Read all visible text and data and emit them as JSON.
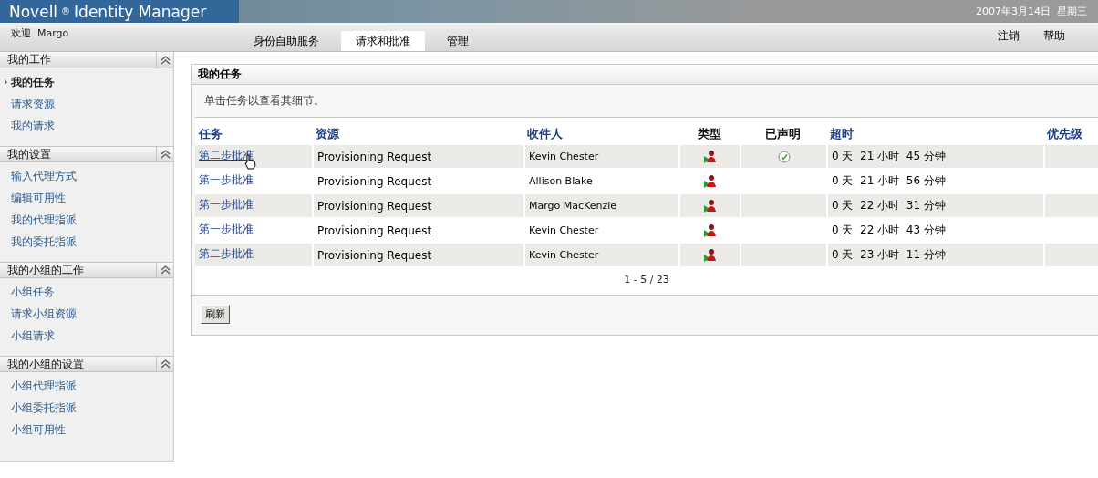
{
  "header": {
    "product": "Novell",
    "trademark": "®",
    "title": "Identity Manager",
    "date": "2007年3月14日  星期三"
  },
  "welcome": "欢迎  Margo",
  "tabs": [
    {
      "label": "身份自助服务",
      "selected": false
    },
    {
      "label": "请求和批准",
      "selected": true
    },
    {
      "label": "管理",
      "selected": false
    }
  ],
  "top_links": [
    "注销",
    "帮助"
  ],
  "sidebar": [
    {
      "title": "我的工作",
      "expanded": true,
      "items": [
        {
          "label": "我的任务",
          "selected": true
        },
        {
          "label": "请求资源",
          "selected": false
        },
        {
          "label": "我的请求",
          "selected": false
        }
      ]
    },
    {
      "title": "我的设置",
      "expanded": true,
      "items": [
        {
          "label": "输入代理方式",
          "selected": false
        },
        {
          "label": "编辑可用性",
          "selected": false
        },
        {
          "label": "我的代理指派",
          "selected": false
        },
        {
          "label": "我的委托指派",
          "selected": false
        }
      ]
    },
    {
      "title": "我的小组的工作",
      "expanded": true,
      "items": [
        {
          "label": "小组任务",
          "selected": false
        },
        {
          "label": "请求小组资源",
          "selected": false
        },
        {
          "label": "小组请求",
          "selected": false
        }
      ]
    },
    {
      "title": "我的小组的设置",
      "expanded": true,
      "items": [
        {
          "label": "小组代理指派",
          "selected": false
        },
        {
          "label": "小组委托指派",
          "selected": false
        },
        {
          "label": "小组可用性",
          "selected": false
        }
      ]
    }
  ],
  "panel": {
    "title": "我的任务",
    "hint": "单击任务以查看其细节。",
    "columns": [
      {
        "label": "任务",
        "sortable": true
      },
      {
        "label": "资源",
        "sortable": true
      },
      {
        "label": "收件人",
        "sortable": true
      },
      {
        "label": "类型",
        "sortable": false
      },
      {
        "label": "已声明",
        "sortable": false
      },
      {
        "label": "超时",
        "sortable": true
      },
      {
        "label": "优先级",
        "sortable": true
      }
    ],
    "rows": [
      {
        "task": "第二步批准",
        "resource": "Provisioning Request",
        "recipient": "Kevin Chester",
        "claimed": true,
        "timeout": "0 天  21 小时  45 分钟",
        "hovered": true
      },
      {
        "task": "第一步批准",
        "resource": "Provisioning Request",
        "recipient": "Allison Blake",
        "claimed": false,
        "timeout": "0 天  21 小时  56 分钟",
        "hovered": false
      },
      {
        "task": "第一步批准",
        "resource": "Provisioning Request",
        "recipient": "Margo MacKenzie",
        "claimed": false,
        "timeout": "0 天  22 小时  31 分钟",
        "hovered": false
      },
      {
        "task": "第一步批准",
        "resource": "Provisioning Request",
        "recipient": "Kevin Chester",
        "claimed": false,
        "timeout": "0 天  22 小时  43 分钟",
        "hovered": false
      },
      {
        "task": "第二步批准",
        "resource": "Provisioning Request",
        "recipient": "Kevin Chester",
        "claimed": false,
        "timeout": "0 天  23 小时  11 分钟",
        "hovered": false
      }
    ],
    "pagination": "1 - 5 / 23",
    "refresh_button": "刷新"
  }
}
